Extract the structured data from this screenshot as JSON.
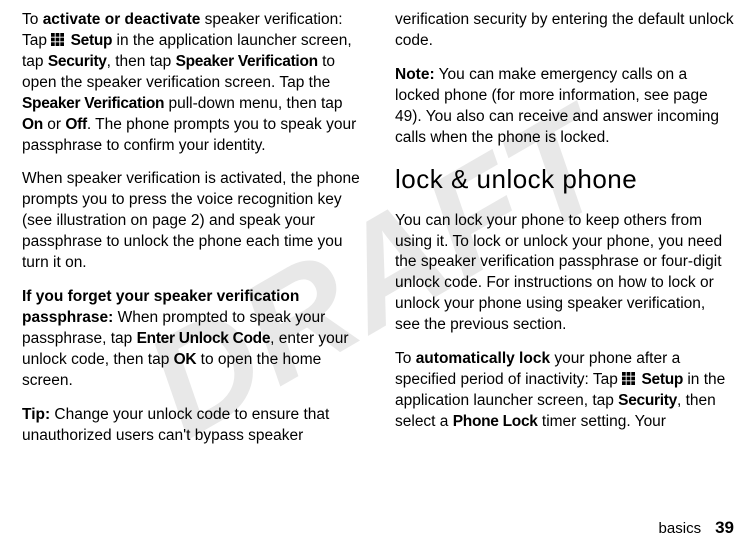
{
  "watermark": "DRAFT",
  "left": {
    "p1_a": "To ",
    "p1_b": "activate or deactivate",
    "p1_c": " speaker verification: Tap ",
    "p1_setup": "Setup",
    "p1_d": " in the application launcher screen, tap ",
    "p1_security": "Security",
    "p1_e": ", then tap ",
    "p1_spkver": "Speaker Verification",
    "p1_f": " to open the speaker verification screen. Tap the ",
    "p1_spkver2": "Speaker Verification",
    "p1_g": " pull-down menu, then tap ",
    "p1_on": "On",
    "p1_h": " or ",
    "p1_off": "Off",
    "p1_i": ". The phone prompts you to speak your passphrase to confirm your identity.",
    "p2": "When speaker verification is activated, the phone prompts you to press the voice recognition key (see illustration on page 2) and speak your passphrase to unlock the phone each time you turn it on.",
    "p3_a": "If you forget your speaker verification passphrase:",
    "p3_b": " When prompted to speak your passphrase, tap ",
    "p3_unlock": "Enter Unlock Code",
    "p3_c": ", enter your unlock code, then tap ",
    "p3_ok": "OK",
    "p3_d": " to open the home screen.",
    "p4_a": "Tip:",
    "p4_b": " Change your unlock code to ensure that unauthorized users can't bypass speaker "
  },
  "right": {
    "p1": "verification security by entering the default unlock code.",
    "p2_a": "Note:",
    "p2_b": " You can make emergency calls on a locked phone (for more information, see page 49). You also can receive and answer incoming calls when the phone is locked.",
    "heading": "lock & unlock phone",
    "p3": "You can lock your phone to keep others from using it. To lock or unlock your phone, you need the speaker verification passphrase or four-digit unlock code. For instructions on how to lock or unlock your phone using speaker verification, see the previous section.",
    "p4_a": "To ",
    "p4_b": "automatically lock",
    "p4_c": " your phone after a specified period of inactivity: Tap ",
    "p4_setup": "Setup",
    "p4_d": " in the application launcher screen, tap ",
    "p4_security": "Security",
    "p4_e": ", then select a ",
    "p4_phonelock": "Phone Lock",
    "p4_f": " timer setting. Your "
  },
  "footer": {
    "label": "basics",
    "page": "39"
  }
}
